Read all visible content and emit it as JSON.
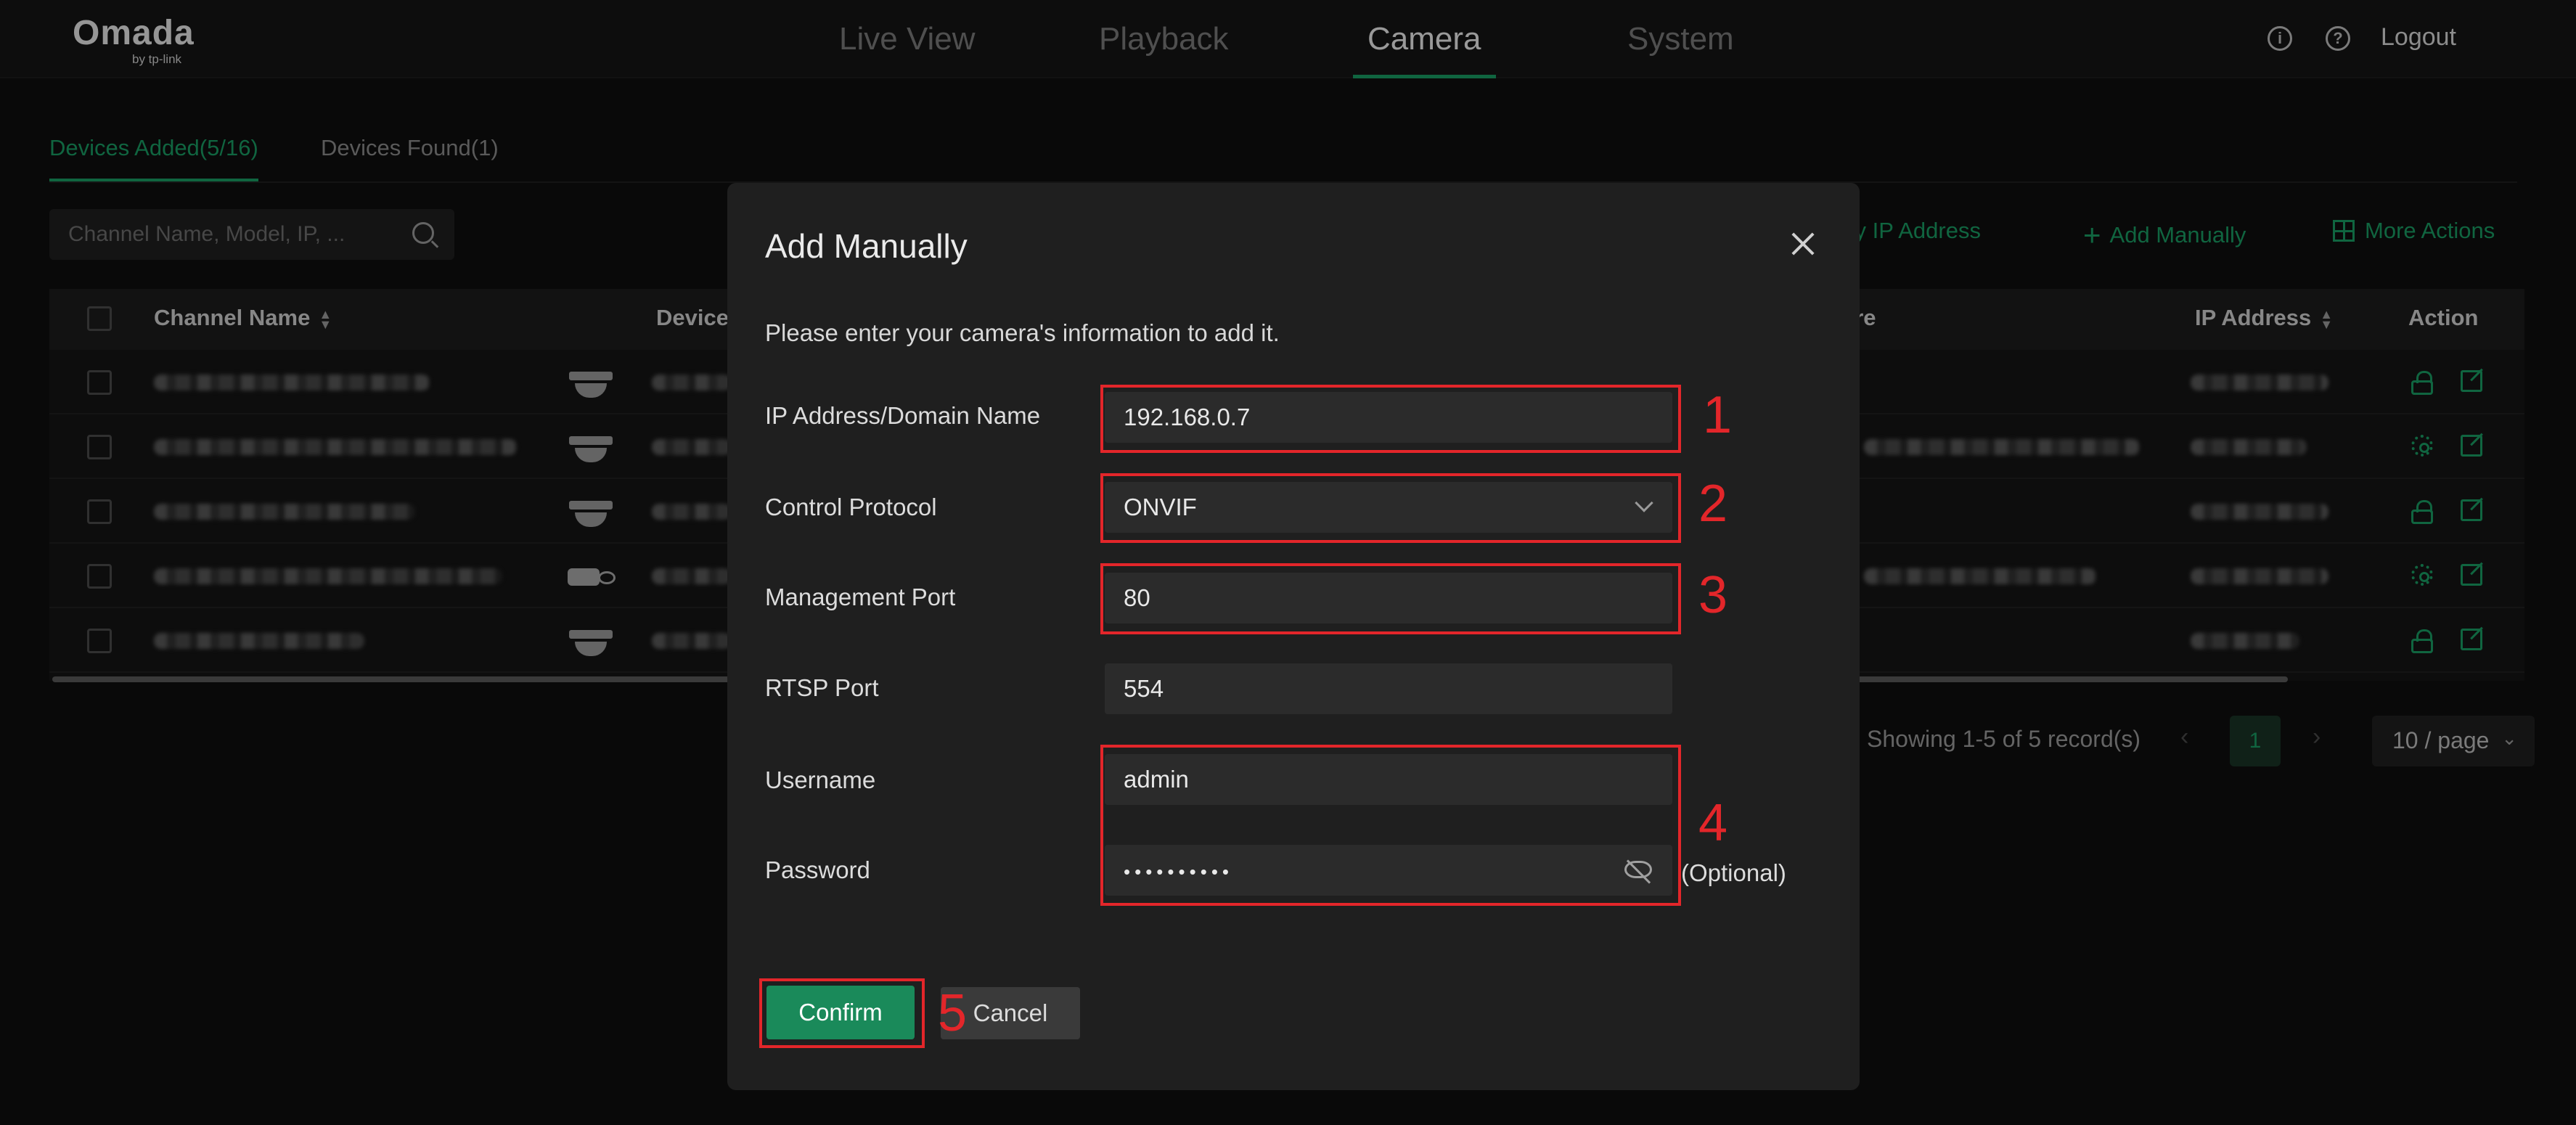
{
  "header": {
    "logo": "Omada",
    "logo_sub": "by tp-link",
    "tabs": [
      {
        "label": "Live View"
      },
      {
        "label": "Playback"
      },
      {
        "label": "Camera"
      },
      {
        "label": "System"
      }
    ],
    "active_tab": "Camera",
    "logout": "Logout"
  },
  "subtabs": [
    {
      "label": "Devices Added(5/16)"
    },
    {
      "label": "Devices Found(1)"
    }
  ],
  "search": {
    "placeholder": "Channel Name, Model, IP, ..."
  },
  "actions": {
    "modify_ip": "ify IP Address",
    "add_manually": "Add Manually",
    "more_actions": "More Actions"
  },
  "table": {
    "columns": [
      "Channel Name",
      "Device",
      "are",
      "IP Address",
      "Action"
    ]
  },
  "pagination": {
    "records": "Showing 1-5 of 5 record(s)",
    "current_page": "1",
    "per_page": "10 / page"
  },
  "modal": {
    "title": "Add Manually",
    "description": "Please enter your camera's information to add it.",
    "fields": {
      "ip": {
        "label": "IP Address/Domain Name",
        "value": "192.168.0.7"
      },
      "protocol": {
        "label": "Control Protocol",
        "value": "ONVIF"
      },
      "mgmt_port": {
        "label": "Management Port",
        "value": "80"
      },
      "rtsp_port": {
        "label": "RTSP Port",
        "value": "554"
      },
      "username": {
        "label": "Username",
        "value": "admin"
      },
      "password": {
        "label": "Password",
        "value": "••••••••••"
      }
    },
    "optional": "(Optional)",
    "confirm": "Confirm",
    "cancel": "Cancel",
    "annotations": [
      "1",
      "2",
      "3",
      "4",
      "5"
    ]
  },
  "colors": {
    "accent": "#1a9b63",
    "annotation": "#e3262a",
    "background": "#0e0e0e",
    "modal": "#1f1f1f"
  }
}
